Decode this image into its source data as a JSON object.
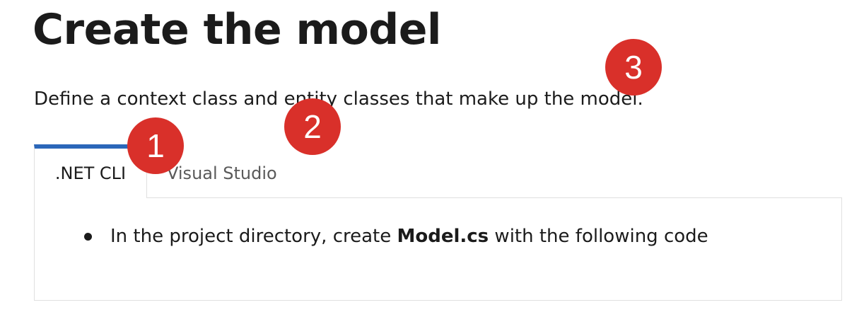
{
  "heading": {
    "title": "Create the model",
    "intro": "Define a context class and entity classes that make up the model."
  },
  "tabs": [
    {
      "label": ".NET CLI",
      "active": true
    },
    {
      "label": "Visual Studio",
      "active": false
    }
  ],
  "panel": {
    "bullet": {
      "prefix": "In the project directory, create ",
      "filename": "Model.cs",
      "suffix": " with the following code"
    }
  },
  "markers": [
    "1",
    "2",
    "3"
  ],
  "colors": {
    "active_tab_accent": "#2b67b9",
    "marker": "#d9302a",
    "text": "#1b1b1b",
    "inactive_tab_text": "#5a5a5a",
    "border": "#e0e0e0"
  }
}
